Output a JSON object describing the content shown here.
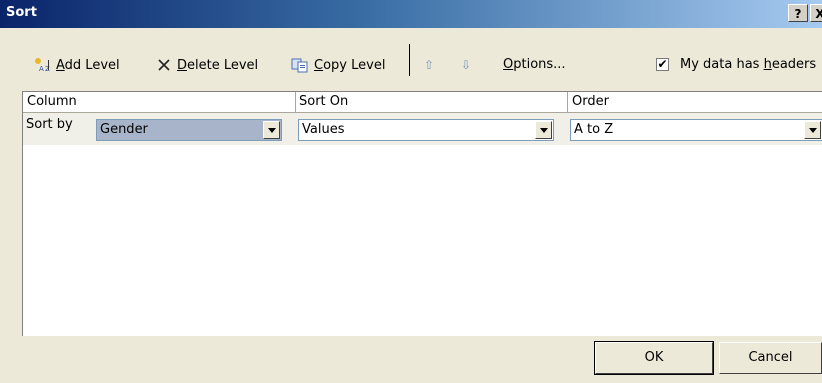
{
  "window": {
    "title": "Sort",
    "help_label": "?",
    "close_label": "X"
  },
  "toolbar": {
    "add_level_prefix": "",
    "add_level_hotkey": "A",
    "add_level_rest": "dd Level",
    "delete_level_hotkey": "D",
    "delete_level_rest": "elete Level",
    "copy_level_hotkey": "C",
    "copy_level_rest": "opy Level",
    "move_up_glyph": "⇧",
    "move_down_glyph": "⇩",
    "options_hotkey": "O",
    "options_rest": "ptions...",
    "headers_checkbox_mark": "✔",
    "headers_label_prefix": "My data has ",
    "headers_label_hotkey": "h",
    "headers_label_rest": "eaders"
  },
  "grid": {
    "headers": [
      "Column",
      "Sort On",
      "Order"
    ],
    "rows": [
      {
        "label": "Sort by",
        "column": "Gender",
        "sort_on": "Values",
        "order": "A to Z"
      }
    ]
  },
  "footer": {
    "ok_label": "OK",
    "cancel_label": "Cancel"
  }
}
